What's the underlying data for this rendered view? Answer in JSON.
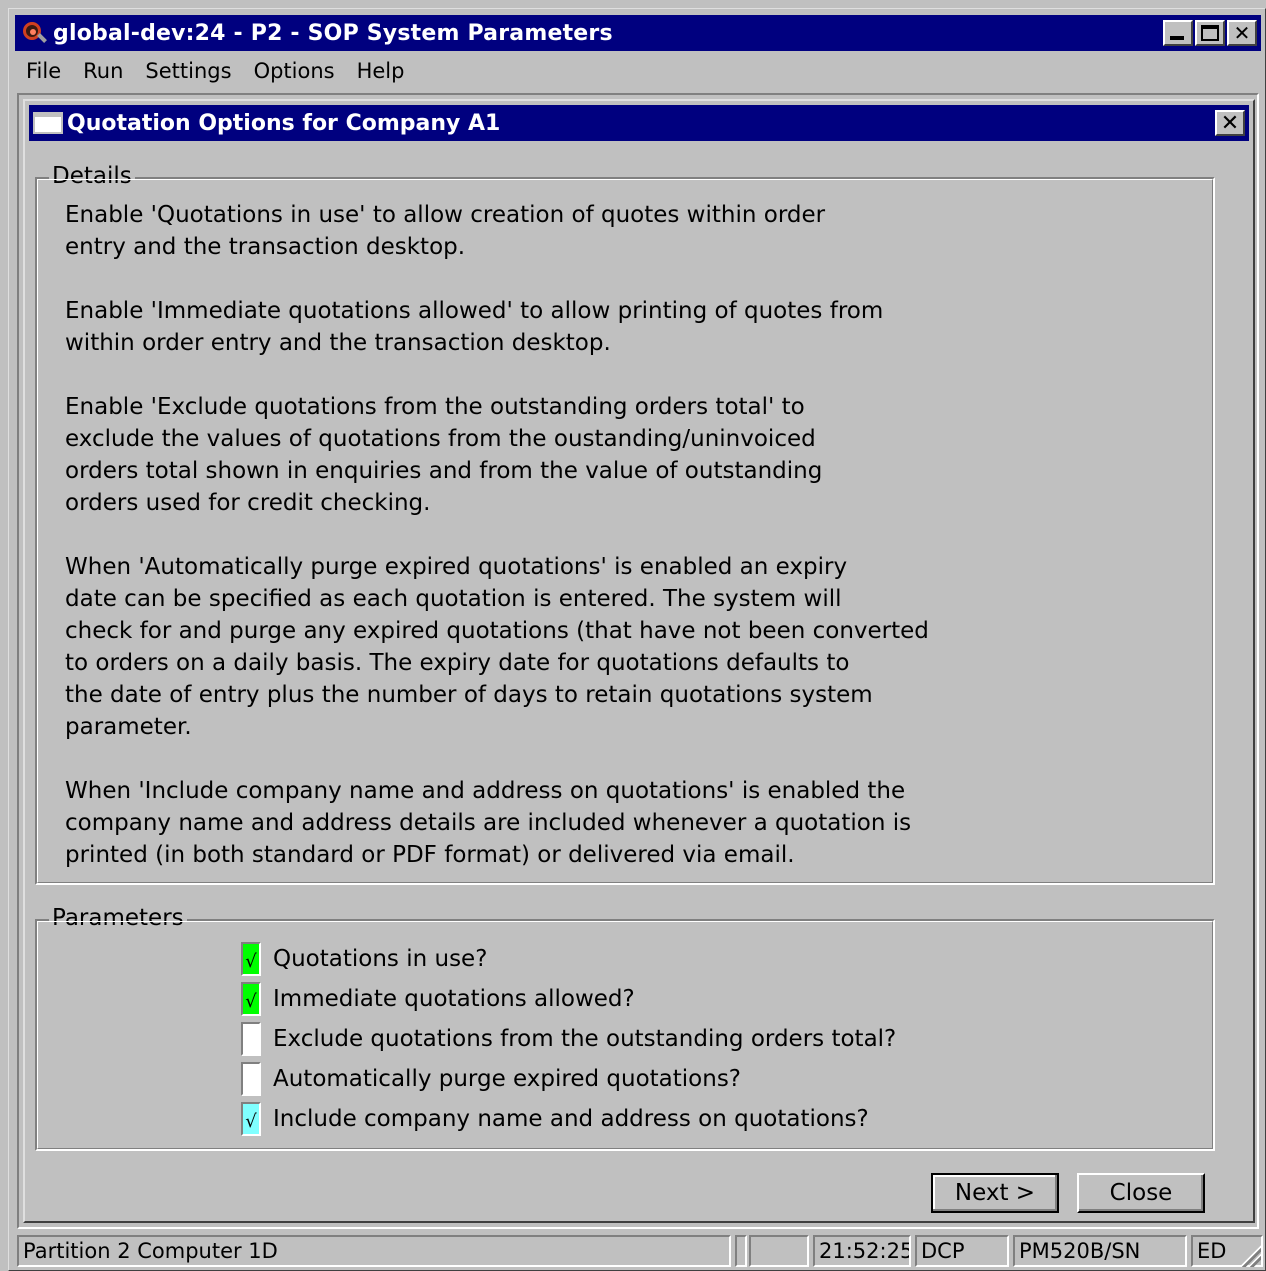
{
  "window": {
    "title": "global-dev:24 - P2 - SOP System Parameters"
  },
  "menu": [
    "File",
    "Run",
    "Settings",
    "Options",
    "Help"
  ],
  "dialog": {
    "title": "Quotation Options for Company A1",
    "close_label": "✕"
  },
  "details": {
    "legend": "Details",
    "paragraphs": [
      "Enable 'Quotations in use' to allow creation of quotes within order\nentry and the transaction desktop.",
      "Enable 'Immediate quotations allowed' to allow printing of quotes from\nwithin order entry and the transaction desktop.",
      "Enable 'Exclude quotations from the outstanding orders total' to\nexclude the values of quotations from the oustanding/uninvoiced\norders total shown in enquiries and from the value of outstanding\norders used for credit checking.",
      "When 'Automatically purge expired quotations' is enabled an expiry\ndate can be specified as each quotation is entered. The system will\ncheck for and purge any expired quotations (that have not been converted\nto orders on a daily basis. The expiry date for quotations defaults to\nthe date of entry plus the number of days to retain quotations system\nparameter.",
      "When 'Include company name and address on quotations' is enabled the\ncompany name and address details are included whenever a quotation is\nprinted (in both standard or PDF format) or delivered via email."
    ]
  },
  "parameters": {
    "legend": "Parameters",
    "checkmark": "√",
    "items": [
      {
        "label": "Quotations in use?",
        "checked": true,
        "color": "#00ff00"
      },
      {
        "label": "Immediate quotations allowed?",
        "checked": true,
        "color": "#00ff00"
      },
      {
        "label": "Exclude quotations from the outstanding orders total?",
        "checked": false,
        "color": "#ffffff"
      },
      {
        "label": "Automatically purge expired quotations?",
        "checked": false,
        "color": "#ffffff"
      },
      {
        "label": "Include company name and address on quotations?",
        "checked": true,
        "color": "#80ffff"
      }
    ]
  },
  "buttons": {
    "next": "Next >",
    "close": "Close"
  },
  "status": {
    "partition": "Partition 2 Computer 1D",
    "time": "21:52:25",
    "system": "DCP",
    "program": "PM520B/SN",
    "mode": "ED"
  }
}
